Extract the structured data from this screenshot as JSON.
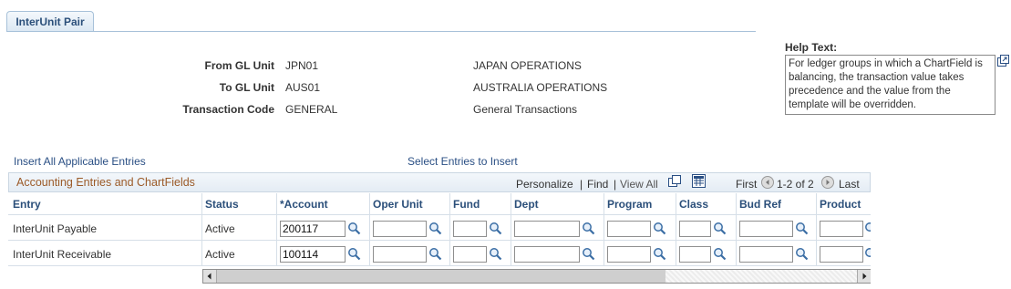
{
  "tab": {
    "label": "InterUnit Pair"
  },
  "form": {
    "from_label": "From GL Unit",
    "from_value": "JPN01",
    "from_desc": "JAPAN OPERATIONS",
    "to_label": "To GL Unit",
    "to_value": "AUS01",
    "to_desc": "AUSTRALIA OPERATIONS",
    "tc_label": "Transaction Code",
    "tc_value": "GENERAL",
    "tc_desc": "General Transactions"
  },
  "help": {
    "label": "Help Text:",
    "text": "For ledger groups in which a ChartField is balancing, the transaction value takes precedence and the value from the template will be overridden."
  },
  "links": {
    "insert_all": "Insert All Applicable Entries",
    "select_entries": "Select Entries to Insert"
  },
  "grid": {
    "title": "Accounting Entries and ChartFields",
    "personalize": "Personalize",
    "sep": "|",
    "find": "Find",
    "view_all": "View All",
    "first": "First",
    "range": "1-2 of 2",
    "last": "Last",
    "columns": [
      "Entry",
      "Status",
      "*Account",
      "Oper Unit",
      "Fund",
      "Dept",
      "Program",
      "Class",
      "Bud Ref",
      "Product"
    ],
    "rows": [
      {
        "entry": "InterUnit Payable",
        "status": "Active",
        "account": "200117"
      },
      {
        "entry": "InterUnit Receivable",
        "status": "Active",
        "account": "100114"
      }
    ]
  }
}
